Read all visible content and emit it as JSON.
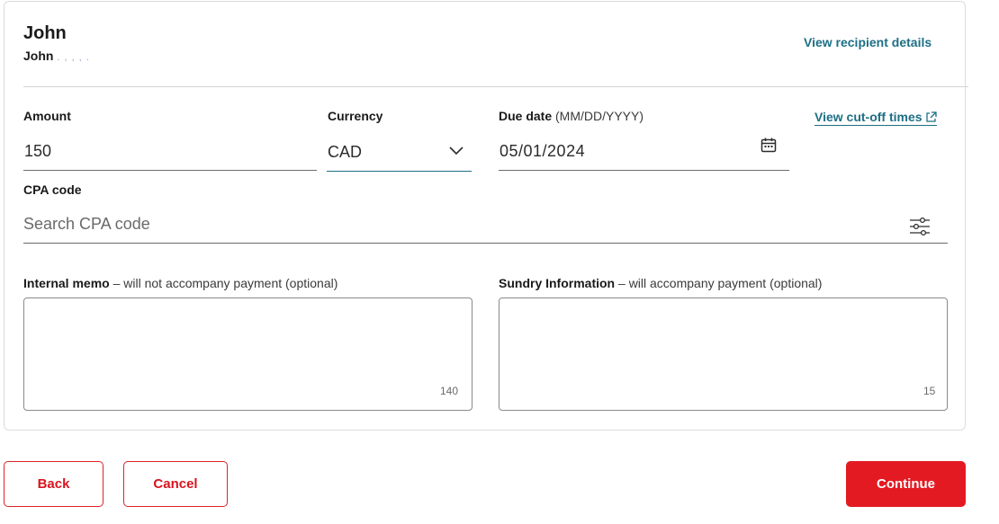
{
  "recipient": {
    "name": "John",
    "sub_name": "John",
    "sub_masked": ".        ,      ,   ,      .",
    "view_details_link": "View recipient details"
  },
  "payment_form": {
    "amount": {
      "label": "Amount",
      "value": "150"
    },
    "currency": {
      "label": "Currency",
      "value": "CAD",
      "icon": "chevron-down-icon"
    },
    "due_date": {
      "label": "Due date",
      "hint": "(MM/DD/YYYY)",
      "value": "05/01/2024",
      "icon": "calendar-icon"
    },
    "cutoff_link": {
      "label": "View cut-off times",
      "icon": "external-link-icon"
    },
    "cpa_code": {
      "label": "CPA code",
      "placeholder": "Search CPA code",
      "value": "",
      "icon": "filter-sliders-icon"
    },
    "internal_memo": {
      "label": "Internal memo",
      "hint": "– will not accompany payment (optional)",
      "value": "",
      "counter": "140"
    },
    "sundry_info": {
      "label": "Sundry Information",
      "hint": "– will accompany payment (optional)",
      "value": "",
      "counter": "15"
    }
  },
  "actions": {
    "back": "Back",
    "cancel": "Cancel",
    "continue": "Continue"
  },
  "colors": {
    "accent_red": "#e41a23",
    "link_teal": "#1c6f85",
    "border_gray": "#dcdcdc"
  }
}
